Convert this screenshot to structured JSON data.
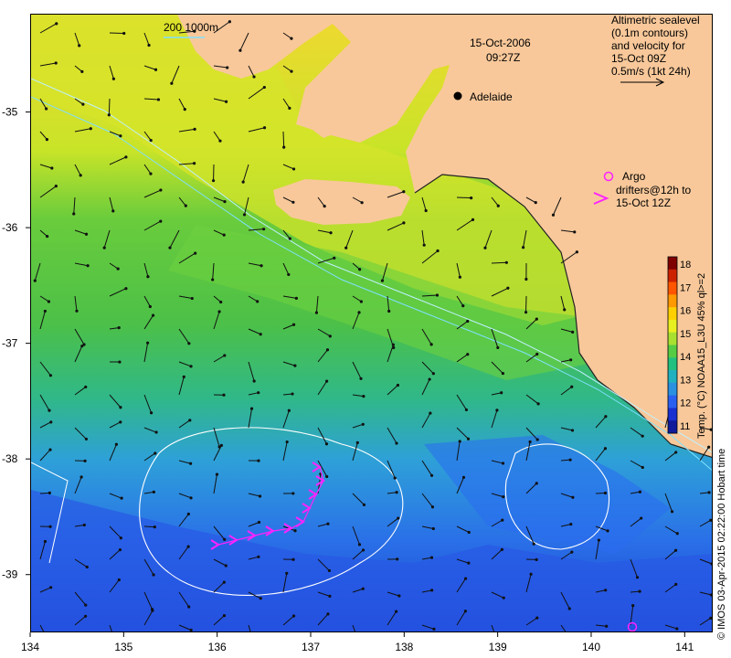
{
  "title_date": "15-Oct-2006",
  "title_time": "09:27Z",
  "legend": {
    "line1": "Altimetric sealevel",
    "line2": "(0.1m contours)",
    "line3": "and velocity for",
    "line4": "15-Oct 09Z",
    "line5": "0.5m/s (1kt 24h)"
  },
  "scale_label": "200  1000m",
  "city": {
    "name": "Adelaide",
    "lon": 138.6,
    "lat": -34.93
  },
  "argo": {
    "line1": "Argo",
    "line2": "drifters@12h to",
    "line3": "15-Oct 12Z"
  },
  "colorbar": {
    "title": "Temp. (°C) NOAA15_L3U 45% ql>=2",
    "ticks": [
      "18",
      "17",
      "16",
      "15",
      "14",
      "13",
      "12",
      "11"
    ],
    "colors": [
      "#7f0000",
      "#cc2200",
      "#ff5500",
      "#ff9900",
      "#ffd000",
      "#e8ef20",
      "#a8e030",
      "#55cc44",
      "#22c080",
      "#20b0c0",
      "#2a90e0",
      "#2a60f0",
      "#1a30d0",
      "#101a9a"
    ]
  },
  "credit": "© IMOS 03-Apr-2015 02:22:00 Hobart time",
  "x_ticks": [
    "134",
    "135",
    "136",
    "137",
    "138",
    "139",
    "140",
    "141"
  ],
  "y_ticks": [
    "-35",
    "-36",
    "-37",
    "-38",
    "-39"
  ],
  "colors": {
    "land": "#f8c89a",
    "sea_warm": "#e8e020",
    "sea_mid": "#55c844",
    "sea_cool": "#2a90e0",
    "sea_cold": "#1a40d8",
    "drifter": "#ff22ff"
  }
}
